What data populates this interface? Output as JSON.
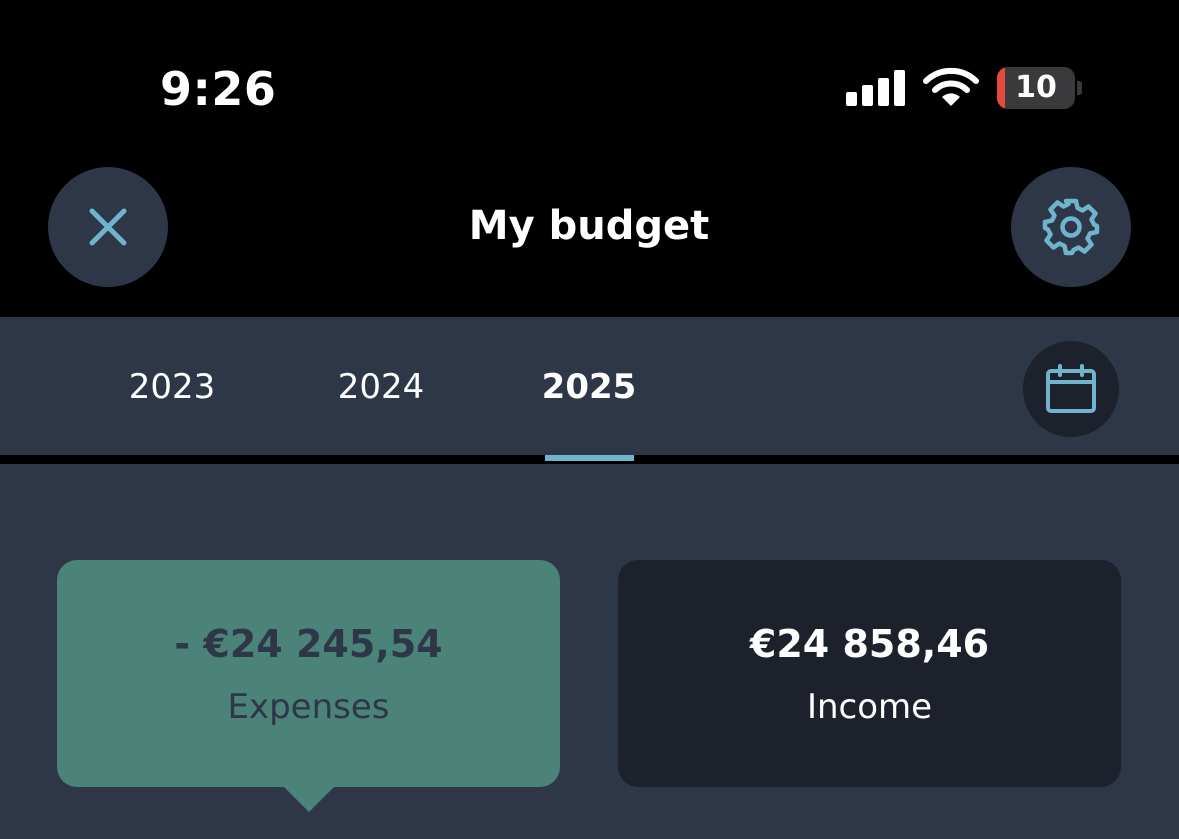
{
  "status_bar": {
    "time": "9:26",
    "battery_level": "10",
    "battery_fraction": 0.1,
    "signal_bars": 4,
    "signal_icon": "cellular-signal-icon",
    "wifi_icon": "wifi-icon",
    "battery_icon": "battery-icon"
  },
  "header": {
    "title": "My budget",
    "close_icon": "close-icon",
    "settings_icon": "gear-icon"
  },
  "tabs": {
    "items": [
      {
        "label": "2023",
        "active": false
      },
      {
        "label": "2024",
        "active": false
      },
      {
        "label": "2025",
        "active": true
      }
    ],
    "calendar_icon": "calendar-icon"
  },
  "summary": {
    "expenses": {
      "amount": "- €24 245,54",
      "label": "Expenses",
      "selected": true
    },
    "income": {
      "amount": "€24 858,46",
      "label": "Income",
      "selected": false
    }
  },
  "colors": {
    "background": "#000000",
    "panel": "#2e3748",
    "accent": "#6fb3cc",
    "expenses_card": "#4b8379",
    "income_card": "#1d212c",
    "battery_low": "#e5493f"
  }
}
